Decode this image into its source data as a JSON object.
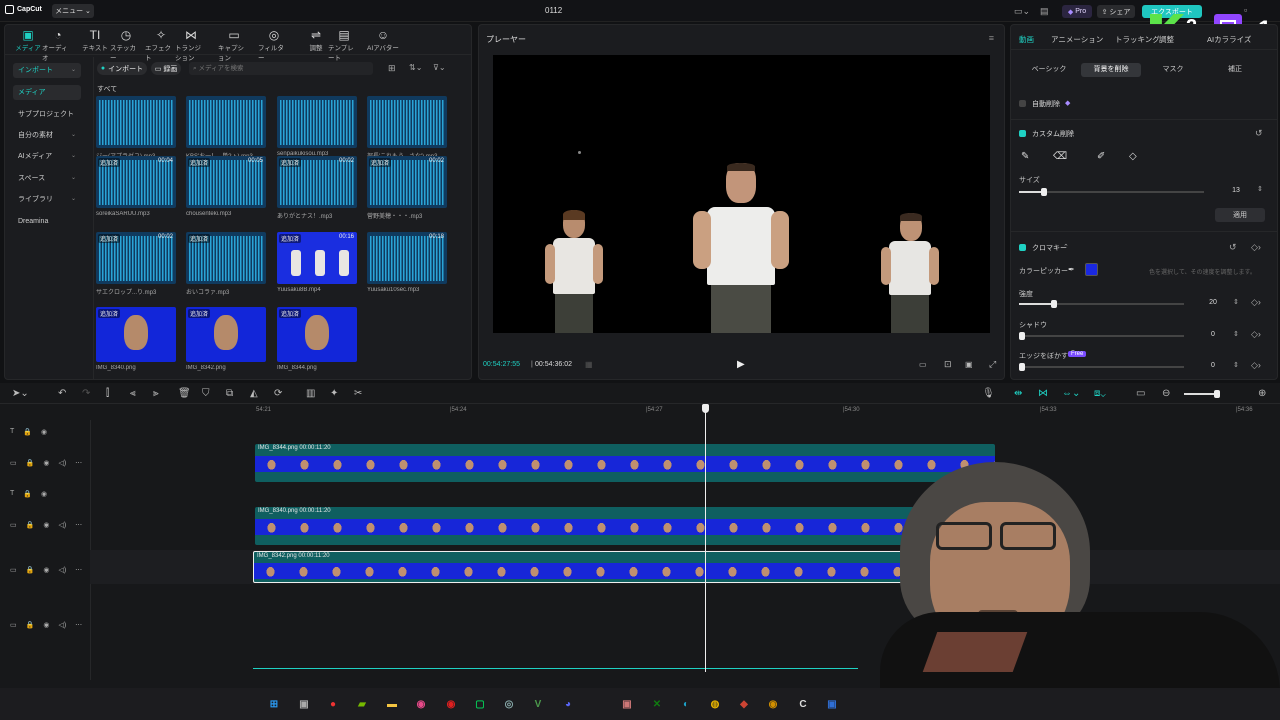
{
  "app": {
    "logo": "CapCut",
    "menu": "メニュー",
    "project_title": "0112"
  },
  "titlebar_right": {
    "pro": "Pro",
    "share": "シェア",
    "export": "エクスポート",
    "badge_num1": "2",
    "badge_num2": "1"
  },
  "toolbar": [
    {
      "label": "メディア",
      "icon": "media-icon",
      "glyph": "▣"
    },
    {
      "label": "オーディオ",
      "icon": "audio-icon",
      "glyph": "◔"
    },
    {
      "label": "テキスト",
      "icon": "text-icon",
      "glyph": "TI"
    },
    {
      "label": "ステッカー",
      "icon": "sticker-icon",
      "glyph": "◷"
    },
    {
      "label": "エフェクト",
      "icon": "effect-icon",
      "glyph": "✧"
    },
    {
      "label": "トランジション",
      "icon": "transition-icon",
      "glyph": "⋈"
    },
    {
      "label": "キャプション",
      "icon": "caption-icon",
      "glyph": "▭"
    },
    {
      "label": "フィルター",
      "icon": "filter-icon",
      "glyph": "◎"
    },
    {
      "label": "調整",
      "icon": "adjust-icon",
      "glyph": "⇌"
    },
    {
      "label": "テンプレート",
      "icon": "template-icon",
      "glyph": "▤"
    },
    {
      "label": "AIアバター",
      "icon": "ai-avatar-icon",
      "glyph": "☺"
    }
  ],
  "sidebar": [
    {
      "label": "インポート",
      "chev": "⌄"
    },
    {
      "label": "メディア",
      "chev": ""
    },
    {
      "label": "サブプロジェクト",
      "chev": ""
    },
    {
      "label": "自分の素材",
      "chev": "⌄"
    },
    {
      "label": "AIメディア",
      "chev": "⌄"
    },
    {
      "label": "スペース",
      "chev": "⌄"
    },
    {
      "label": "ライブラリ",
      "chev": "⌄"
    },
    {
      "label": "Dreamina",
      "chev": ""
    }
  ],
  "media_toolbar": {
    "import": "インポート",
    "record": "録画",
    "search_placeholder": "メディアを検索",
    "all": "すべて"
  },
  "media": [
    {
      "name": "ジー(アプラゼユ).mp3",
      "tag": "",
      "dur": "",
      "kind": "audio"
    },
    {
      "name": "KBS'お一！...単?ょ).mp3",
      "tag": "",
      "dur": "",
      "kind": "audio"
    },
    {
      "name": "senpaikukisou.mp3",
      "tag": "",
      "dur": "",
      "kind": "audio"
    },
    {
      "name": "部長'これもう...さな').mp3",
      "tag": "",
      "dur": "",
      "kind": "audio"
    },
    {
      "name": "soreikaSARUU.mp3",
      "tag": "追加済",
      "dur": "00:04",
      "kind": "audio"
    },
    {
      "name": "chousenteki.mp3",
      "tag": "追加済",
      "dur": "00:05",
      "kind": "audio"
    },
    {
      "name": "ありがとナス！.mp3",
      "tag": "追加済",
      "dur": "00:02",
      "kind": "audio"
    },
    {
      "name": "菅野美穂・・・.mp3",
      "tag": "追加済",
      "dur": "00:02",
      "kind": "audio"
    },
    {
      "name": "サエクロップ...り.mp3",
      "tag": "追加済",
      "dur": "00:02",
      "kind": "audio"
    },
    {
      "name": "おいコラァ.mp3",
      "tag": "追加済",
      "dur": "",
      "kind": "audio"
    },
    {
      "name": "Yuusaku8B.mp4",
      "tag": "追加済",
      "dur": "00:16",
      "kind": "video"
    },
    {
      "name": "Yuusaku10sec.mp3",
      "tag": "",
      "dur": "00:18",
      "kind": "audio"
    },
    {
      "name": "IMG_8340.png",
      "tag": "追加済",
      "dur": "",
      "kind": "face"
    },
    {
      "name": "IMG_8342.png",
      "tag": "追加済",
      "dur": "",
      "kind": "face"
    },
    {
      "name": "IMG_8344.png",
      "tag": "追加済",
      "dur": "",
      "kind": "face"
    }
  ],
  "player": {
    "title": "プレーヤー",
    "current": "00:54:27:55",
    "total": "00:54:36:02"
  },
  "right_tabs": [
    "動画",
    "アニメーション",
    "トラッキング",
    "調整",
    "AIカラライズ"
  ],
  "segments": [
    "ベーシック",
    "背景を削除",
    "マスク",
    "補正"
  ],
  "bg": {
    "auto_remove": "自動削除",
    "custom_remove": "カスタム削除",
    "size_label": "サイズ",
    "size_value": "13",
    "apply": "適用",
    "chroma": "クロマキー",
    "color_picker": "カラーピッカー",
    "picker_hint": "色を選択して、その速度を調整します。",
    "color": "#1a28e0",
    "strength_label": "強度",
    "strength_value": "20",
    "shadow_label": "シャドウ",
    "shadow_value": "0",
    "edge_label": "エッジをぼかす",
    "edge_badge": "Free",
    "edge_value": "0"
  },
  "timeline": {
    "ticks": [
      "54:21",
      "|54:24",
      "|54:27",
      "|54:30",
      "|54:33",
      "|54:36"
    ],
    "tracks": [
      {
        "label": "IMG_8344.png  00:00:11:20"
      },
      {
        "label": "IMG_8340.png  00:00:11:20"
      },
      {
        "label": "IMG_8342.png  00:00:11:20"
      }
    ]
  }
}
